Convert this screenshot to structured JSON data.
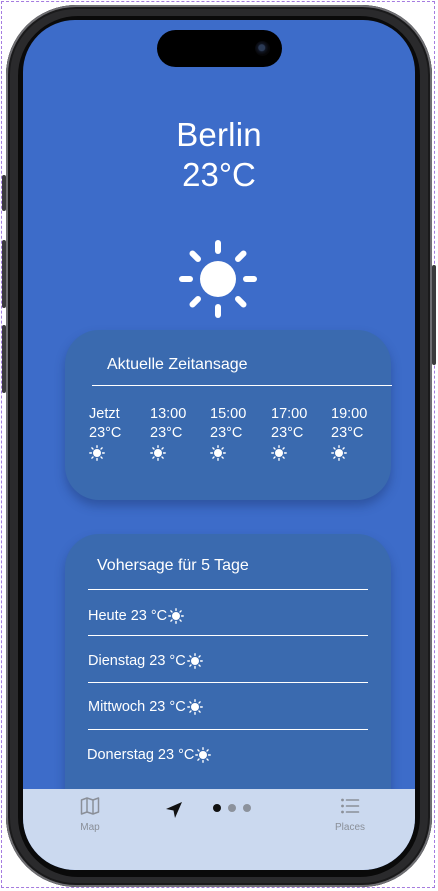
{
  "weather": {
    "city": "Berlin",
    "temperature": "23°C"
  },
  "hourly": {
    "title": "Aktuelle Zeitansage",
    "items": [
      {
        "time": "Jetzt",
        "temp": "23°C",
        "icon": "sun-icon"
      },
      {
        "time": "13:00",
        "temp": "23°C",
        "icon": "sun-icon"
      },
      {
        "time": "15:00",
        "temp": "23°C",
        "icon": "sun-icon"
      },
      {
        "time": "17:00",
        "temp": "23°C",
        "icon": "sun-icon"
      },
      {
        "time": "19:00",
        "temp": "23°C",
        "icon": "sun-icon"
      }
    ]
  },
  "daily": {
    "title": "Vohersage für 5 Tage",
    "items": [
      {
        "label": "Heute 23 °C",
        "icon": "sun-icon"
      },
      {
        "label": "Dienstag 23 °C",
        "icon": "sun-icon"
      },
      {
        "label": "Mittwoch 23 °C",
        "icon": "sun-icon"
      },
      {
        "label": "Donerstag 23 °C",
        "icon": "sun-icon"
      }
    ]
  },
  "tabbar": {
    "map_label": "Map",
    "places_label": "Places",
    "page_count": 3,
    "active_page": 1
  },
  "colors": {
    "screen_bg": "#3d6cc9",
    "card_bg": "#3a6aaf",
    "tabbar_bg": "#cbd9ef"
  }
}
